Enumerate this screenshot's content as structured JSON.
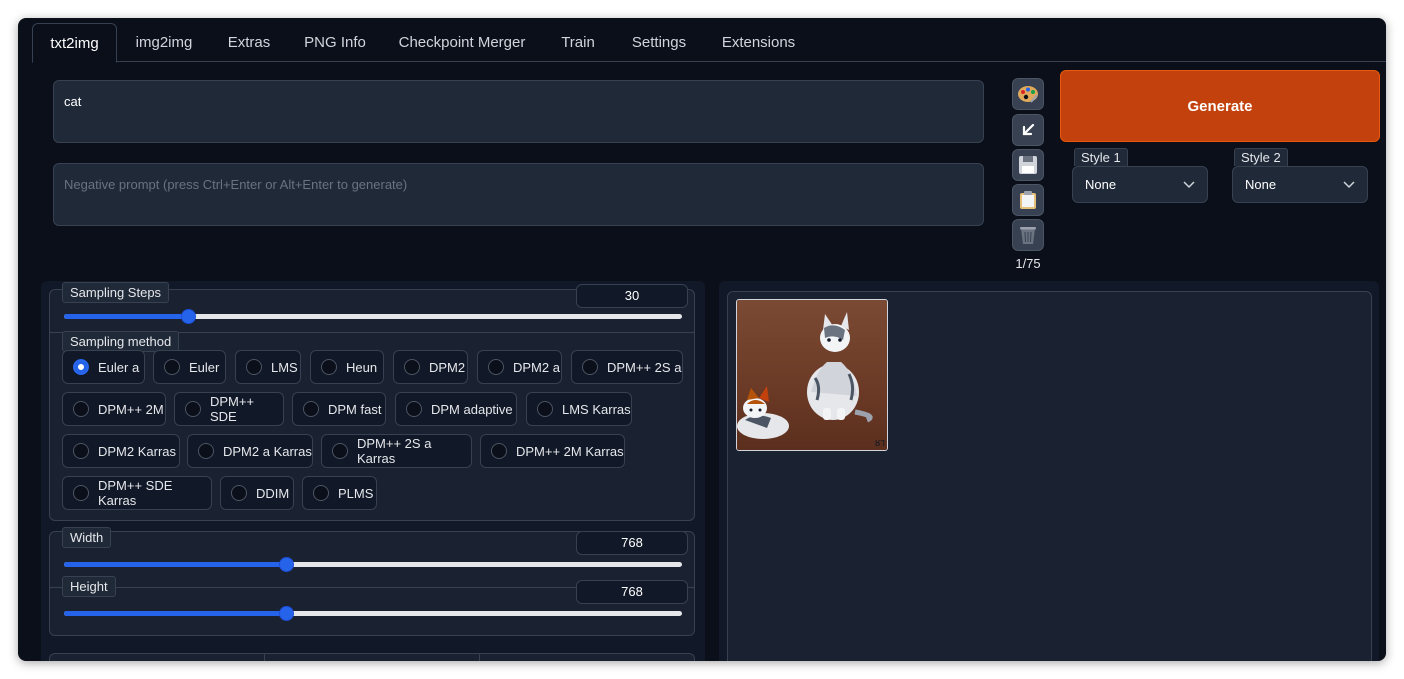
{
  "tabs": [
    {
      "label": "txt2img",
      "active": true
    },
    {
      "label": "img2img"
    },
    {
      "label": "Extras"
    },
    {
      "label": "PNG Info"
    },
    {
      "label": "Checkpoint Merger"
    },
    {
      "label": "Train"
    },
    {
      "label": "Settings"
    },
    {
      "label": "Extensions"
    }
  ],
  "prompt": {
    "value": "cat"
  },
  "negative_prompt": {
    "value": "",
    "placeholder": "Negative prompt (press Ctrl+Enter or Alt+Enter to generate)"
  },
  "tools": {
    "icons": [
      "palette-icon",
      "arrow-down-left-icon",
      "save-icon",
      "clipboard-icon",
      "trash-icon"
    ],
    "token_count": "1/75"
  },
  "generate": {
    "label": "Generate",
    "color": "#c2410c"
  },
  "styles": [
    {
      "label": "Style 1",
      "value": "None"
    },
    {
      "label": "Style 2",
      "value": "None"
    }
  ],
  "sampling_steps": {
    "label": "Sampling Steps",
    "value": "30",
    "fraction": 0.2
  },
  "sampling_method": {
    "label": "Sampling method",
    "selected": "Euler a",
    "options": [
      "Euler a",
      "Euler",
      "LMS",
      "Heun",
      "DPM2",
      "DPM2 a",
      "DPM++ 2S a",
      "DPM++ 2M",
      "DPM++ SDE",
      "DPM fast",
      "DPM adaptive",
      "LMS Karras",
      "DPM2 Karras",
      "DPM2 a Karras",
      "DPM++ 2S a Karras",
      "DPM++ 2M Karras",
      "DPM++ SDE Karras",
      "DDIM",
      "PLMS"
    ]
  },
  "width": {
    "label": "Width",
    "value": "768",
    "fraction": 0.36
  },
  "height": {
    "label": "Height",
    "value": "768",
    "fraction": 0.36
  },
  "colors": {
    "accent": "#2563eb",
    "background": "#0b0f19",
    "panel": "#1f2937"
  }
}
